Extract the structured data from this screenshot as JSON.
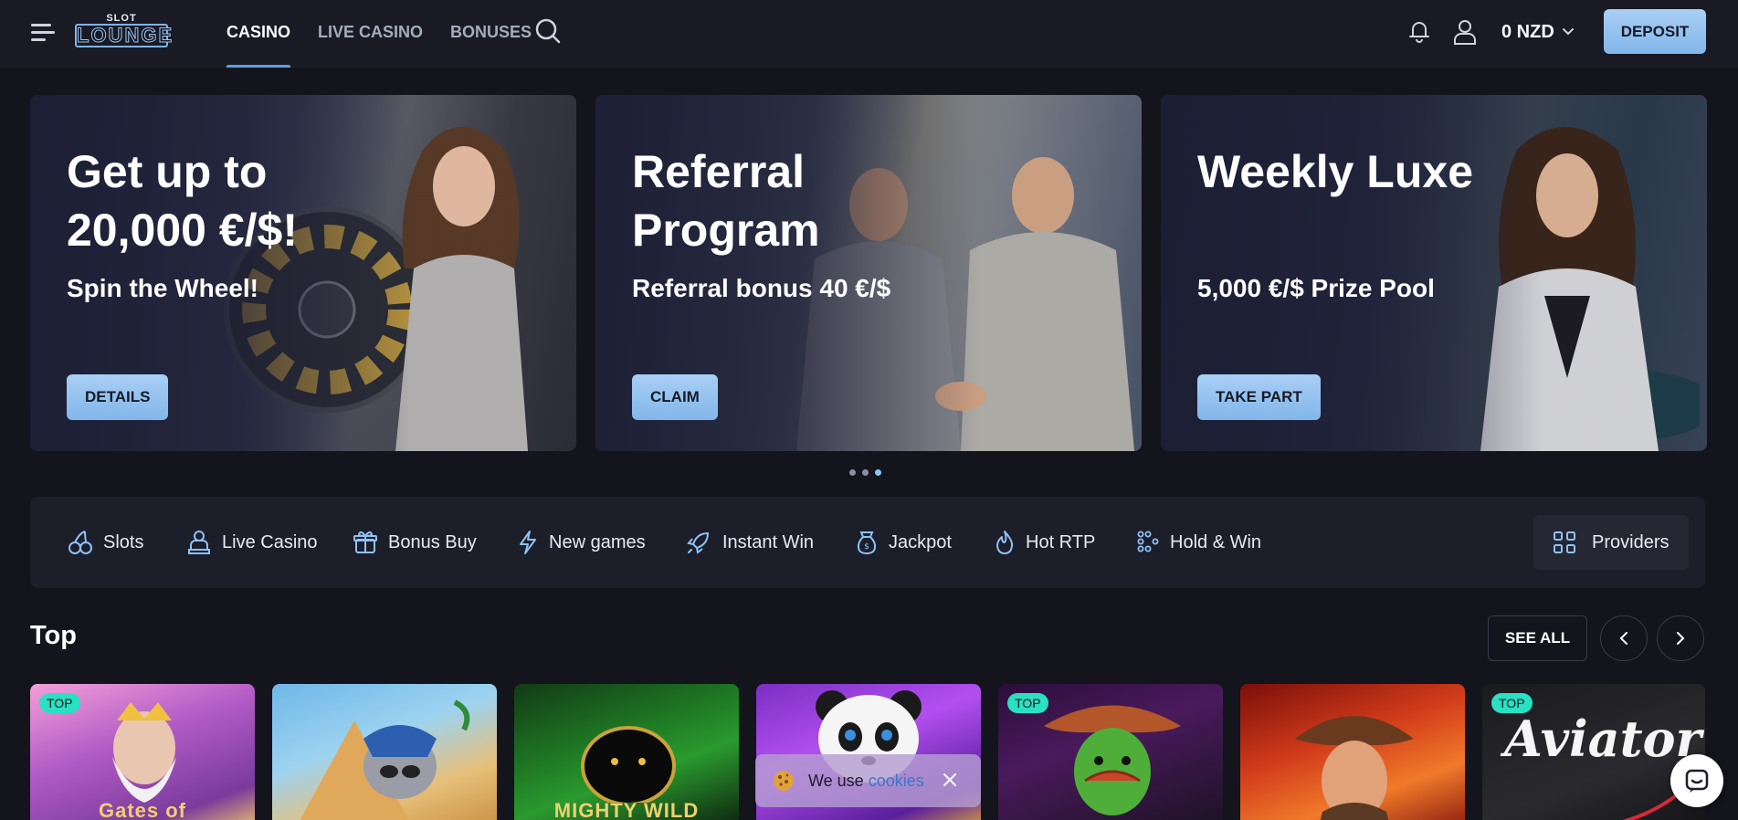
{
  "header": {
    "logo_top": "SLOT",
    "logo_main": "LOUNGE",
    "nav": [
      {
        "label": "CASINO",
        "active": true
      },
      {
        "label": "LIVE CASINO",
        "active": false
      },
      {
        "label": "BONUSES",
        "active": false
      }
    ],
    "balance": "0 NZD",
    "deposit_label": "DEPOSIT",
    "icons": [
      "menu-icon",
      "search-icon",
      "bell-icon",
      "user-icon",
      "chevron-down-icon"
    ]
  },
  "banners": [
    {
      "title": "Get up to 20,000 €/$!",
      "subtitle": "Spin the Wheel!",
      "button": "DETAILS"
    },
    {
      "title": "Referral Program",
      "subtitle": "Referral bonus 40 €/$",
      "button": "CLAIM"
    },
    {
      "title": "Weekly Luxe",
      "subtitle": "5,000 €/$ Prize Pool",
      "button": "TAKE PART"
    }
  ],
  "carousel": {
    "dots": 3,
    "active_index": 2
  },
  "categories": [
    {
      "label": "Slots",
      "icon": "cherries-icon"
    },
    {
      "label": "Live Casino",
      "icon": "dealer-icon"
    },
    {
      "label": "Bonus Buy",
      "icon": "gift-icon"
    },
    {
      "label": "New games",
      "icon": "lightning-icon"
    },
    {
      "label": "Instant Win",
      "icon": "rocket-icon"
    },
    {
      "label": "Jackpot",
      "icon": "money-bag-icon"
    },
    {
      "label": "Hot RTP",
      "icon": "flame-icon"
    },
    {
      "label": "Hold & Win",
      "icon": "grid-dots-icon"
    }
  ],
  "providers_label": "Providers",
  "top_section": {
    "title": "Top",
    "see_all": "SEE ALL",
    "badge": "TOP",
    "games": [
      {
        "badge": true,
        "caption": "Gates of"
      },
      {
        "badge": false,
        "caption": ""
      },
      {
        "badge": false,
        "caption": "MIGHTY WILD"
      },
      {
        "badge": false,
        "caption": ""
      },
      {
        "badge": true,
        "caption": ""
      },
      {
        "badge": false,
        "caption": ""
      },
      {
        "badge": true,
        "caption": "Aviator"
      }
    ]
  },
  "cookie": {
    "text": "We use",
    "link": "cookies"
  },
  "colors": {
    "accent": "#8fc2f5",
    "background": "#13141c",
    "header": "#191a24",
    "badge": "#2ae0c2"
  }
}
